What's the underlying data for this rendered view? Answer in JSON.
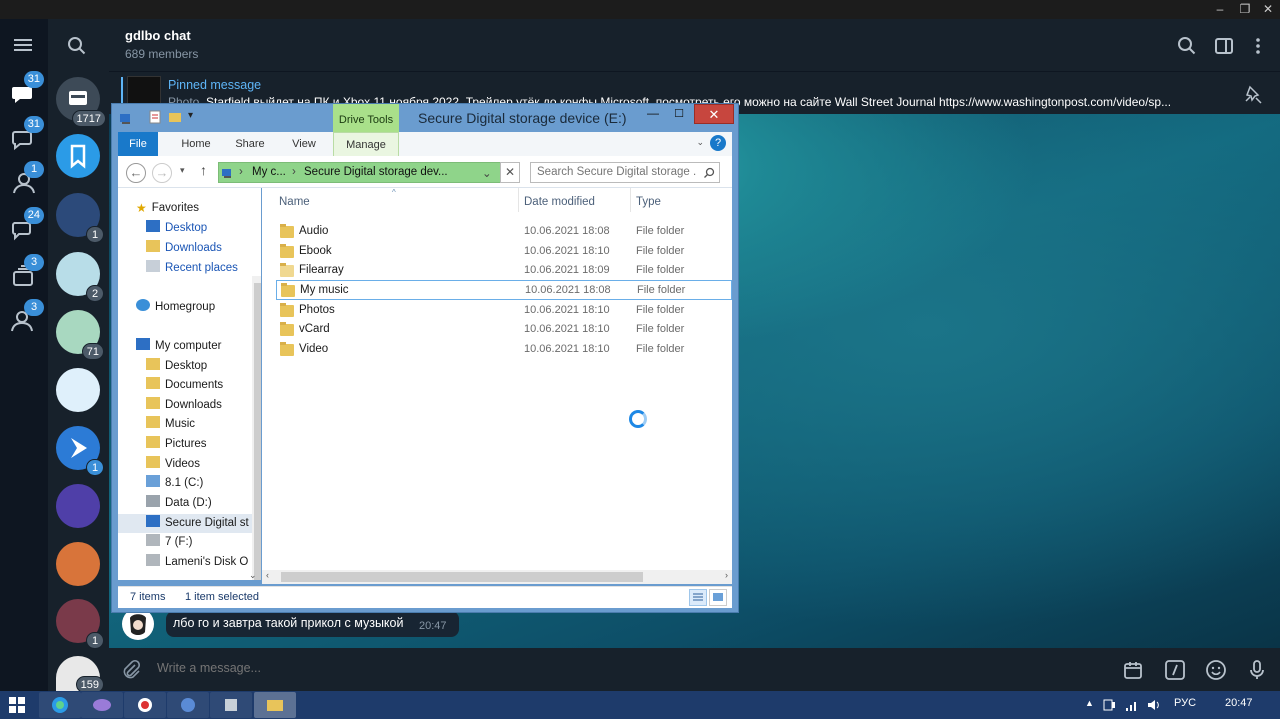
{
  "window_controls": {
    "minimize": "–",
    "restore": "❐",
    "close": "✕"
  },
  "folders": [
    {
      "name": "all-chats",
      "badge": "31"
    },
    {
      "name": "unread",
      "badge": "31"
    },
    {
      "name": "personal",
      "badge": "1"
    },
    {
      "name": "groups",
      "badge": "24"
    },
    {
      "name": "channels",
      "badge": "3"
    },
    {
      "name": "contacts",
      "badge": "3"
    }
  ],
  "chats": [
    {
      "badge": "1717",
      "color": "#3d4a57"
    },
    {
      "badge": "",
      "color": "#2b9be7"
    },
    {
      "badge": "1",
      "color": "#2c4a7a"
    },
    {
      "badge": "2",
      "color": "#b8dde8"
    },
    {
      "badge": "71",
      "color": "#a8d8c0"
    },
    {
      "badge": "",
      "color": "#dff0fb"
    },
    {
      "badge": "1",
      "color": "#2c7bd6"
    },
    {
      "badge": "",
      "color": "#4f3fa8"
    },
    {
      "badge": "",
      "color": "#d8743a"
    },
    {
      "badge": "1",
      "color": "#7a3a4a"
    },
    {
      "badge": "159",
      "color": "#e8e8e8"
    }
  ],
  "header": {
    "title": "gdlbo chat",
    "subtitle": "689 members"
  },
  "pinned": {
    "title": "Pinned message",
    "prefix": "Photo, ",
    "text": "Starfield выйдет на ПК и Xbox 11 ноября 2022. Трейлер утёк до конфы Microsoft, посмотреть его можно на сайте Wall Street Journal  https://www.washingtonpost.com/video/sp..."
  },
  "message": {
    "text": "лбо го и завтра такой прикол с музыкой",
    "time": "20:47"
  },
  "composer": {
    "placeholder": "Write a message..."
  },
  "explorer": {
    "title": "Secure Digital storage device (E:)",
    "drive_tools": "Drive Tools",
    "tabs": {
      "file": "File",
      "home": "Home",
      "share": "Share",
      "view": "View",
      "manage": "Manage"
    },
    "help": "?",
    "address": {
      "part1": "My c...",
      "part2": "Secure Digital storage dev..."
    },
    "search_placeholder": "Search Secure Digital storage ...",
    "nav": {
      "favorites": "Favorites",
      "desktop": "Desktop",
      "downloads": "Downloads",
      "recent": "Recent places",
      "homegroup": "Homegroup",
      "computer": "My computer",
      "c_desktop": "Desktop",
      "documents": "Documents",
      "c_downloads": "Downloads",
      "music": "Music",
      "pictures": "Pictures",
      "videos": "Videos",
      "c_drive": "8.1 (C:)",
      "d_drive": "Data (D:)",
      "e_drive": "Secure Digital st",
      "f_drive": "7 (F:)",
      "lameni": "Lameni's Disk O"
    },
    "columns": {
      "name": "Name",
      "date": "Date modified",
      "type": "Type"
    },
    "files": [
      {
        "name": "Audio",
        "date": "10.06.2021 18:08",
        "type": "File folder"
      },
      {
        "name": "Ebook",
        "date": "10.06.2021 18:10",
        "type": "File folder"
      },
      {
        "name": "Filearray",
        "date": "10.06.2021 18:09",
        "type": "File folder"
      },
      {
        "name": "My music",
        "date": "10.06.2021 18:08",
        "type": "File folder"
      },
      {
        "name": "Photos",
        "date": "10.06.2021 18:10",
        "type": "File folder"
      },
      {
        "name": "vCard",
        "date": "10.06.2021 18:10",
        "type": "File folder"
      },
      {
        "name": "Video",
        "date": "10.06.2021 18:10",
        "type": "File folder"
      }
    ],
    "status": {
      "items": "7 items",
      "selected": "1 item selected"
    }
  },
  "taskbar": {
    "lang": "РУС",
    "time": "20:47"
  },
  "colors": {
    "accent": "#5eb5f7",
    "badge": "#3a8fd8",
    "sidebar": "#0e1621",
    "panel": "#17212b",
    "taskbar": "#1e3b6b"
  }
}
